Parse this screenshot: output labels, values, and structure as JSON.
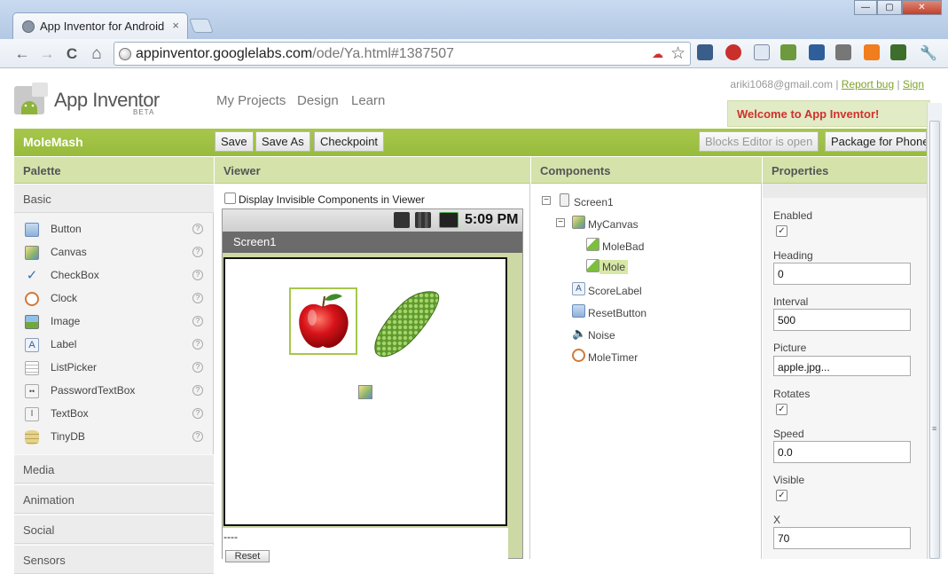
{
  "browser": {
    "tab_title": "App Inventor for Android",
    "tab_close": "×",
    "url_host": "appinventor.googlelabs.com",
    "url_path": "/ode/Ya.html#1387507",
    "window_buttons": [
      "—",
      "▢",
      "✕"
    ],
    "nav": {
      "back": "←",
      "forward": "→",
      "reload": "C",
      "home": "⌂"
    }
  },
  "app": {
    "name": "App Inventor",
    "beta": "BETA",
    "nav": [
      "My Projects",
      "Design",
      "Learn"
    ],
    "account_email": "ariki1068@gmail.com",
    "account_sep": "|",
    "report_bug": "Report bug",
    "sign": "Sign",
    "welcome": "Welcome to App Inventor!"
  },
  "project": {
    "name": "MoleMash",
    "buttons": {
      "save": "Save",
      "save_as": "Save As",
      "checkpoint": "Checkpoint",
      "blocks_editor": "Blocks Editor is open",
      "package": "Package for Phone"
    }
  },
  "palette": {
    "header": "Palette",
    "open_category": "Basic",
    "items": [
      {
        "label": "Button",
        "icon": "button-icon"
      },
      {
        "label": "Canvas",
        "icon": "canvas-icon"
      },
      {
        "label": "CheckBox",
        "icon": "checkbox-icon"
      },
      {
        "label": "Clock",
        "icon": "clock-icon"
      },
      {
        "label": "Image",
        "icon": "image-icon"
      },
      {
        "label": "Label",
        "icon": "label-icon"
      },
      {
        "label": "ListPicker",
        "icon": "listpicker-icon"
      },
      {
        "label": "PasswordTextBox",
        "icon": "password-icon"
      },
      {
        "label": "TextBox",
        "icon": "textbox-icon"
      },
      {
        "label": "TinyDB",
        "icon": "database-icon"
      }
    ],
    "help_glyph": "?",
    "categories": [
      "Media",
      "Animation",
      "Social",
      "Sensors"
    ]
  },
  "viewer": {
    "header": "Viewer",
    "display_invisible": "Display Invisible Components in Viewer",
    "display_invisible_checked": false,
    "status_time": "5:09 PM",
    "screen_title": "Screen1",
    "score_text": "----",
    "reset_button": "Reset"
  },
  "components": {
    "header": "Components",
    "tree": [
      {
        "label": "Screen1",
        "icon": "screen-icon",
        "toggle": "⊟"
      },
      {
        "label": "MyCanvas",
        "icon": "canvas-icon",
        "toggle": "⊟"
      },
      {
        "label": "MoleBad",
        "icon": "sprite-icon"
      },
      {
        "label": "Mole",
        "icon": "sprite-icon",
        "selected": true
      },
      {
        "label": "ScoreLabel",
        "icon": "label-icon"
      },
      {
        "label": "ResetButton",
        "icon": "button-icon"
      },
      {
        "label": "Noise",
        "icon": "sound-icon"
      },
      {
        "label": "MoleTimer",
        "icon": "clock-icon"
      }
    ]
  },
  "properties": {
    "header": "Properties",
    "enabled_label": "Enabled",
    "enabled": true,
    "heading_label": "Heading",
    "heading": "0",
    "interval_label": "Interval",
    "interval": "500",
    "picture_label": "Picture",
    "picture": "apple.jpg...",
    "rotates_label": "Rotates",
    "rotates": true,
    "speed_label": "Speed",
    "speed": "0.0",
    "visible_label": "Visible",
    "visible": true,
    "x_label": "X",
    "x": "70",
    "check_glyph": "✓"
  },
  "colors": {
    "brand_green": "#a6c74b",
    "panel_head": "#d5e3ab",
    "welcome_red": "#d0312d"
  }
}
